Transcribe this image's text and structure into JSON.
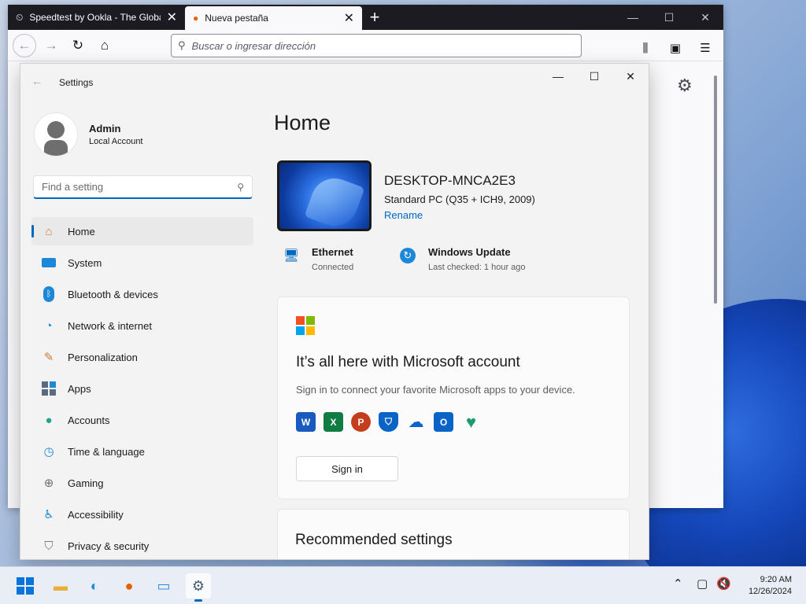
{
  "browser": {
    "tabs": [
      {
        "title": "Speedtest by Ookla - The Globa"
      },
      {
        "title": "Nueva pestaña"
      }
    ],
    "url_placeholder": "Buscar o ingresar dirección"
  },
  "settings": {
    "window_title": "Settings",
    "user": {
      "name": "Admin",
      "account_type": "Local Account"
    },
    "search_placeholder": "Find a setting",
    "nav": [
      {
        "label": "Home",
        "icon": "home-icon"
      },
      {
        "label": "System",
        "icon": "system-icon"
      },
      {
        "label": "Bluetooth & devices",
        "icon": "bluetooth-icon"
      },
      {
        "label": "Network & internet",
        "icon": "network-icon"
      },
      {
        "label": "Personalization",
        "icon": "brush-icon"
      },
      {
        "label": "Apps",
        "icon": "apps-icon"
      },
      {
        "label": "Accounts",
        "icon": "accounts-icon"
      },
      {
        "label": "Time & language",
        "icon": "clock-globe-icon"
      },
      {
        "label": "Gaming",
        "icon": "gamepad-icon"
      },
      {
        "label": "Accessibility",
        "icon": "accessibility-icon"
      },
      {
        "label": "Privacy & security",
        "icon": "shield-icon"
      }
    ],
    "page_title": "Home",
    "device": {
      "name": "DESKTOP-MNCA2E3",
      "model": "Standard PC (Q35 + ICH9, 2009)",
      "rename": "Rename"
    },
    "status": {
      "ethernet": {
        "title": "Ethernet",
        "sub": "Connected"
      },
      "update": {
        "title": "Windows Update",
        "sub": "Last checked: 1 hour ago"
      }
    },
    "ms_card": {
      "title": "It’s all here with Microsoft account",
      "desc": "Sign in to connect your favorite Microsoft apps to your device.",
      "signin": "Sign in"
    },
    "recommended_title": "Recommended settings"
  },
  "taskbar": {
    "time": "9:20 AM",
    "date": "12/26/2024"
  }
}
